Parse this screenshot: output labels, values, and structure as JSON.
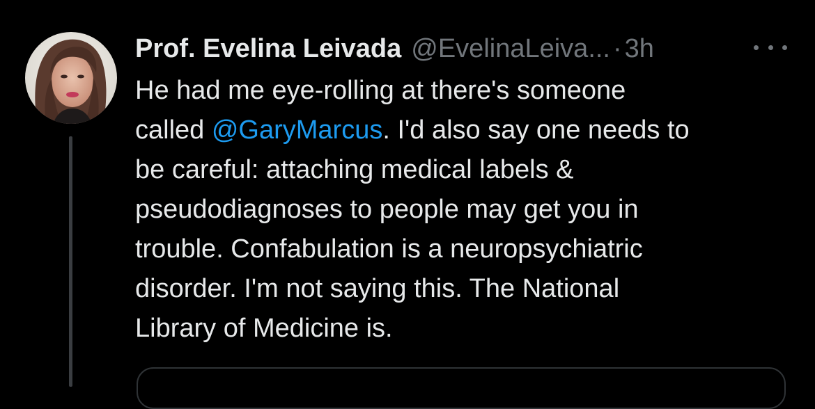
{
  "tweet": {
    "author_name": "Prof. Evelina Leivada",
    "author_handle": "@EvelinaLeiva...",
    "separator": "·",
    "timestamp": "3h",
    "more_icon": "more-horizontal-icon",
    "body": {
      "line1": "He had me eye-rolling at there's someone",
      "line2_before": "called ",
      "line2_mention": "@GaryMarcus",
      "line2_after": ". I'd also say one needs to",
      "line3": "be careful: attaching medical labels &",
      "line4": "pseudodiagnoses to people may get you in",
      "line5": "trouble. Confabulation is a neuropsychiatric",
      "line6": "disorder. I'm not saying this. The National",
      "line7": "Library of Medicine is."
    }
  },
  "colors": {
    "background": "#000000",
    "text_primary": "#e7e9ea",
    "text_secondary": "#71767b",
    "link": "#1d9bf0",
    "thread_line": "#3a3d41",
    "card_border": "#2f3336"
  }
}
